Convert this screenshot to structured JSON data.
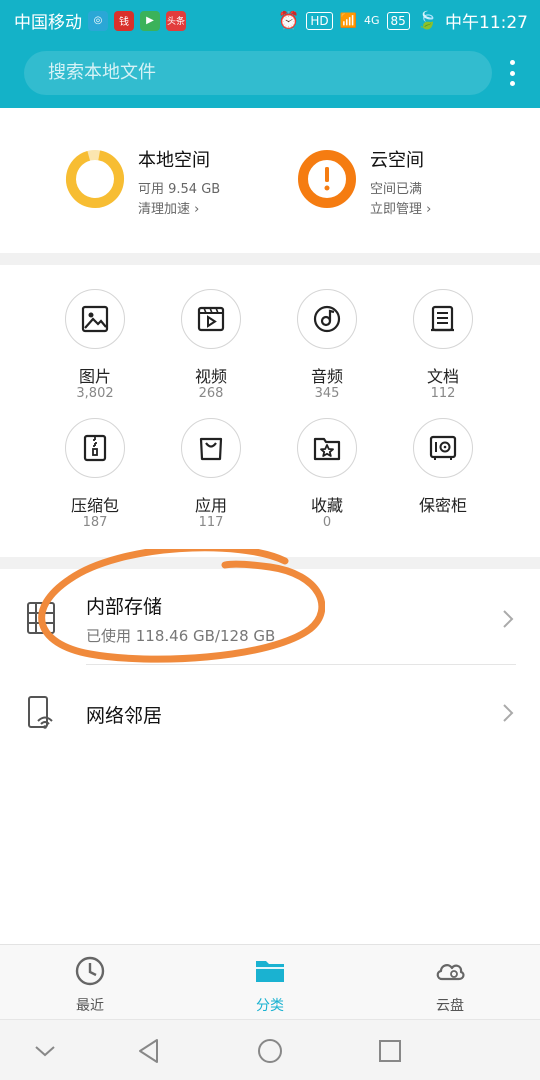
{
  "status_bar": {
    "carrier": "中国移动",
    "apps": [
      {
        "name": "app-icon-1",
        "color": "#2aa7d6",
        "text": ""
      },
      {
        "name": "app-icon-2",
        "color": "#d9312b",
        "text": "钱"
      },
      {
        "name": "app-icon-3",
        "color": "#3bb25a",
        "text": ""
      },
      {
        "name": "app-icon-4",
        "color": "#e23c3c",
        "text": "头条"
      }
    ],
    "hd": "HD",
    "network": "4G",
    "battery": "85",
    "time": "中午11:27"
  },
  "search": {
    "placeholder": "搜索本地文件"
  },
  "storage": {
    "local": {
      "title": "本地空间",
      "available": "可用 9.54 GB",
      "link": "清理加速"
    },
    "cloud": {
      "title": "云空间",
      "status": "空间已满",
      "link": "立即管理"
    }
  },
  "categories": [
    {
      "label": "图片",
      "count": "3,802",
      "icon": "image-icon"
    },
    {
      "label": "视频",
      "count": "268",
      "icon": "video-icon"
    },
    {
      "label": "音频",
      "count": "345",
      "icon": "audio-icon"
    },
    {
      "label": "文档",
      "count": "112",
      "icon": "document-icon"
    },
    {
      "label": "压缩包",
      "count": "187",
      "icon": "archive-icon"
    },
    {
      "label": "应用",
      "count": "117",
      "icon": "app-bag-icon"
    },
    {
      "label": "收藏",
      "count": "0",
      "icon": "star-folder-icon"
    },
    {
      "label": "保密柜",
      "count": "",
      "icon": "safe-icon"
    }
  ],
  "list": {
    "internal": {
      "title": "内部存储",
      "usage": "已使用 118.46 GB/128 GB"
    },
    "network": {
      "title": "网络邻居"
    }
  },
  "tabs": [
    {
      "label": "最近",
      "icon": "clock-icon",
      "active": false
    },
    {
      "label": "分类",
      "icon": "folder-icon",
      "active": true
    },
    {
      "label": "云盘",
      "icon": "cloud-icon",
      "active": false
    }
  ],
  "colors": {
    "accent": "#14b2c8",
    "local_ring": "#f7bd33",
    "cloud_ring": "#f57c11",
    "annotation": "#f08a3c"
  }
}
